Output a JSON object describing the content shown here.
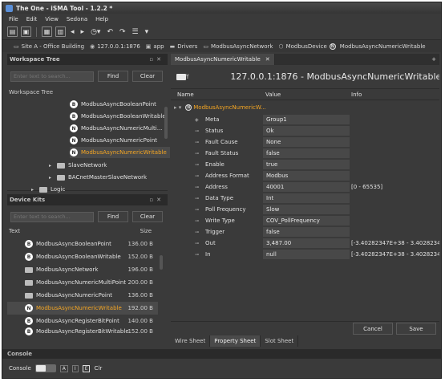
{
  "window": {
    "title": "The One - iSMA Tool - 1.2.2 *"
  },
  "menu": [
    "File",
    "Edit",
    "View",
    "Sedona",
    "Help"
  ],
  "breadcrumb": [
    "Site A - Office Building",
    "127.0.0.1:1876",
    "app",
    "Drivers",
    "ModbusAsyncNetwork",
    "ModbusDevice",
    "ModbusAsyncNumericWritable"
  ],
  "workspace": {
    "title": "Workspace Tree",
    "search_placeholder": "Enter text to search...",
    "find": "Find",
    "clear": "Clear",
    "label": "Workspace Tree",
    "items": [
      {
        "icon": "B",
        "label": "ModbusAsyncBooleanPoint"
      },
      {
        "icon": "B",
        "label": "ModbusAsyncBooleanWritable"
      },
      {
        "icon": "N",
        "label": "ModbusAsyncNumericMulti..."
      },
      {
        "icon": "N",
        "label": "ModbusAsyncNumericPoint"
      },
      {
        "icon": "N",
        "label": "ModbusAsyncNumericWritable"
      }
    ],
    "folders": [
      "SlaveNetwork",
      "BACnetMasterSlaveNetwork",
      "Logic"
    ]
  },
  "device_kits": {
    "title": "Device Kits",
    "search_placeholder": "Enter text to search...",
    "find": "Find",
    "clear": "Clear",
    "col_text": "Text",
    "col_size": "Size",
    "items": [
      {
        "icon": "B",
        "label": "ModbusAsyncBooleanPoint",
        "size": "136.00 B"
      },
      {
        "icon": "B",
        "label": "ModbusAsyncBooleanWritable",
        "size": "152.00 B"
      },
      {
        "icon": "",
        "label": "ModbusAsyncNetwork",
        "size": "196.00 B"
      },
      {
        "icon": "",
        "label": "ModbusAsyncNumericMultiPoint",
        "size": "200.00 B"
      },
      {
        "icon": "",
        "label": "ModbusAsyncNumericPoint",
        "size": "136.00 B"
      },
      {
        "icon": "N",
        "label": "ModbusAsyncNumericWritable",
        "size": "192.00 B"
      },
      {
        "icon": "B",
        "label": "ModbusAsyncRegisterBitPoint",
        "size": "140.00 B"
      },
      {
        "icon": "B",
        "label": "ModbusAsyncRegisterBitWritable",
        "size": "152.00 B"
      }
    ]
  },
  "editor": {
    "tab": "ModbusAsyncNumericWritable",
    "toggle_label": "Off",
    "header_title": "127.0.0.1:1876 - ModbusAsyncNumericWritable",
    "col_name": "Name",
    "col_value": "Value",
    "col_info": "Info",
    "root": "ModbusAsyncNumericW...",
    "props": [
      {
        "name": "Meta",
        "value": "Group1",
        "info": ""
      },
      {
        "name": "Status",
        "value": "Ok",
        "info": ""
      },
      {
        "name": "Fault Cause",
        "value": "None",
        "info": ""
      },
      {
        "name": "Fault Status",
        "value": "false",
        "info": ""
      },
      {
        "name": "Enable",
        "value": "true",
        "info": ""
      },
      {
        "name": "Address Format",
        "value": "Modbus",
        "info": ""
      },
      {
        "name": "Address",
        "value": "40001",
        "info": "[0 - 65535]"
      },
      {
        "name": "Data Type",
        "value": "Int",
        "info": ""
      },
      {
        "name": "Poll Frequency",
        "value": "Slow",
        "info": ""
      },
      {
        "name": "Write Type",
        "value": "COV_PollFrequency",
        "info": ""
      },
      {
        "name": "Trigger",
        "value": "false",
        "info": ""
      },
      {
        "name": "Out",
        "value": "3,487.00",
        "info": "[-3.40282347E+38 - 3.4028234..."
      },
      {
        "name": "In",
        "value": "null",
        "info": "[-3.40282347E+38 - 3.4028234..."
      }
    ],
    "cancel": "Cancel",
    "save": "Save",
    "sheet_tabs": [
      "Wire Sheet",
      "Property Sheet",
      "Slot Sheet"
    ]
  },
  "console": {
    "title": "Console",
    "label": "Console",
    "a": "A",
    "i": "I",
    "e": "E",
    "clr": "Clr"
  }
}
